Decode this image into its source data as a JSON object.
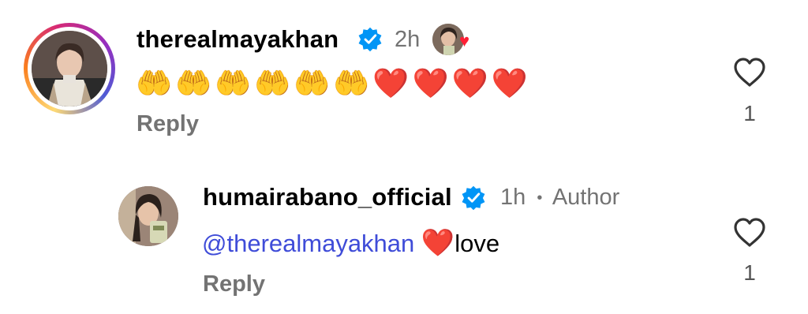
{
  "comments": [
    {
      "username": "therealmayakhan",
      "time": "2h",
      "emoji": {
        "hands": "🤲🤲🤲🤲🤲🤲",
        "hearts": "❤️❤️❤️❤️"
      },
      "reply_label": "Reply",
      "like_count": "1"
    },
    {
      "username": "humairabano_official",
      "time": "1h",
      "separator": "•",
      "author_badge": "Author",
      "mention": "@therealmayakhan",
      "heart": "❤️",
      "text": "love",
      "reply_label": "Reply",
      "like_count": "1"
    }
  ],
  "icons": {
    "verified": "verified-badge-icon",
    "like": "heart-outline-icon",
    "mention_prefix": "threads-at-icon"
  },
  "colors": {
    "verified": "#0095f6",
    "mention": "#3f4cd8",
    "heart": "#e0192b",
    "muted": "#737373"
  }
}
